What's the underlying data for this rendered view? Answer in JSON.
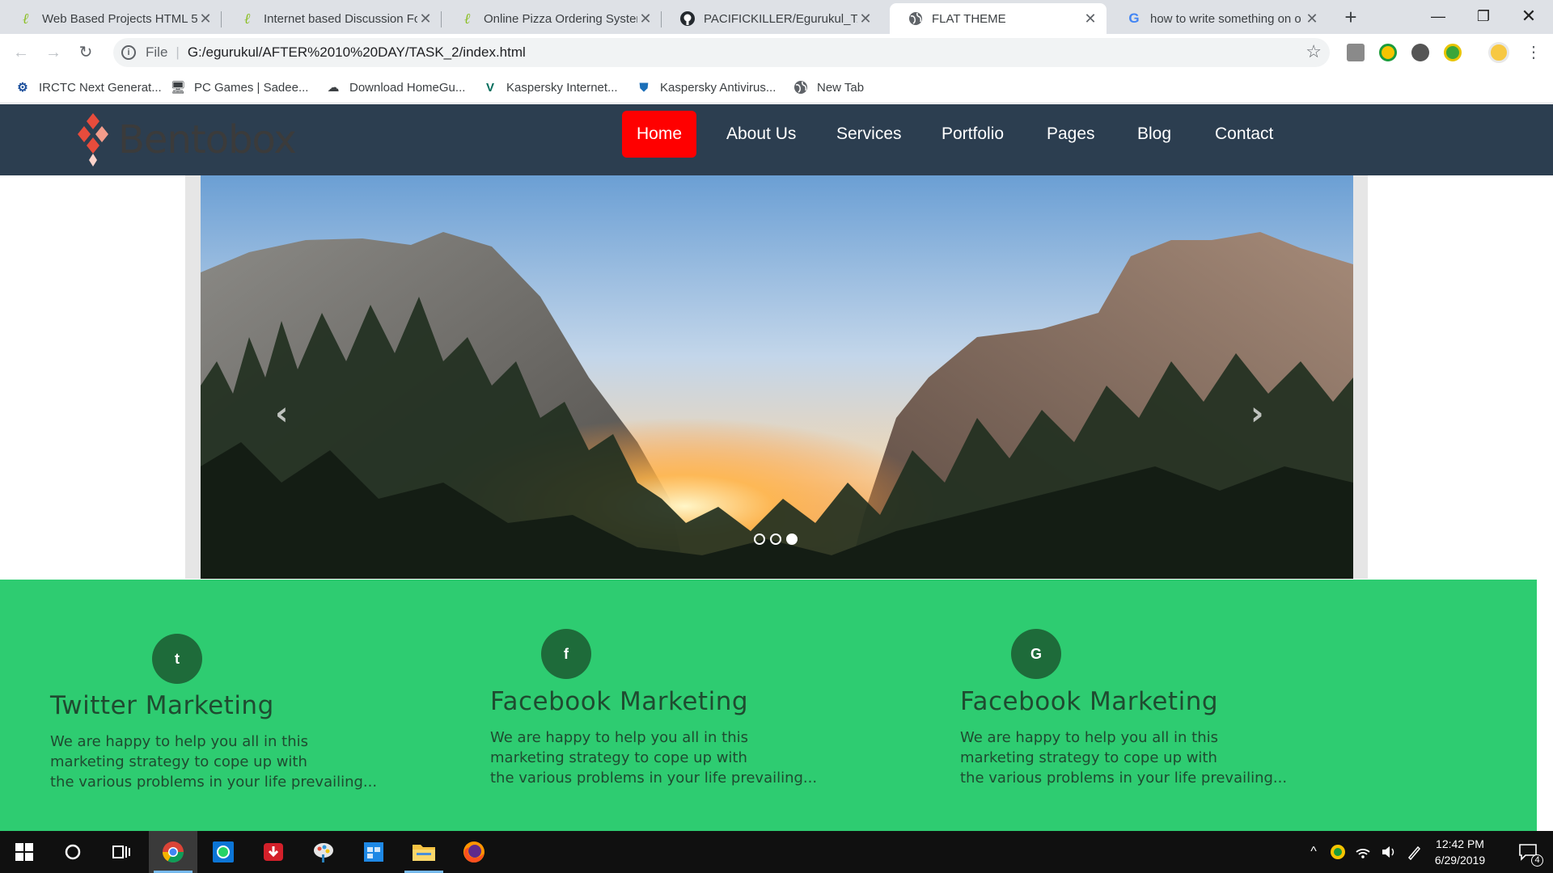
{
  "browser": {
    "tabs": [
      {
        "title": "Web Based Projects HTML 5 (",
        "icon": "leaf-icon",
        "active": false
      },
      {
        "title": "Internet based Discussion Fo",
        "icon": "leaf-icon",
        "active": false
      },
      {
        "title": "Online Pizza Ordering Systen",
        "icon": "leaf-icon",
        "active": false
      },
      {
        "title": "PACIFICKILLER/Egurukul_TAS",
        "icon": "github-icon",
        "active": false
      },
      {
        "title": "FLAT THEME",
        "icon": "globe-icon",
        "active": true
      },
      {
        "title": "how to write something on o",
        "icon": "google-icon",
        "active": false
      }
    ],
    "address": {
      "scheme": "File",
      "url": "G:/egurukul/AFTER%2010%20DAY/TASK_2/index.html"
    },
    "bookmarks": [
      {
        "label": "IRCTC Next Generat...",
        "icon": "irctc-icon"
      },
      {
        "label": "PC Games | Sadee...",
        "icon": "monitor-icon"
      },
      {
        "label": "Download HomeGu...",
        "icon": "cloud-download-icon"
      },
      {
        "label": "Kaspersky Internet...",
        "icon": "kaspersky-v-icon"
      },
      {
        "label": "Kaspersky Antivirus...",
        "icon": "shield-icon"
      },
      {
        "label": "New Tab",
        "icon": "globe-icon"
      }
    ]
  },
  "site": {
    "logo_text": "Bentobox",
    "nav": [
      "Home",
      "About Us",
      "Services",
      "Portfolio",
      "Pages",
      "Blog",
      "Contact"
    ],
    "active_nav": "Home",
    "slider": {
      "slides": 3,
      "active_slide": 3,
      "prev_icon": "chevron-left-icon",
      "next_icon": "chevron-right-icon"
    },
    "features": [
      {
        "icon_glyph": "t",
        "icon": "twitter-icon",
        "title": "Twitter Marketing",
        "lines": [
          "We are happy to help you all in this",
          "marketing strategy to cope up with",
          "the various problems in your life prevailing..."
        ]
      },
      {
        "icon_glyph": "f",
        "icon": "facebook-icon",
        "title": "Facebook Marketing",
        "lines": [
          "We are happy to help you all in this",
          "marketing strategy to cope up with",
          "the various problems in your life prevailing..."
        ]
      },
      {
        "icon_glyph": "G",
        "icon": "google-icon",
        "title": "Facebook Marketing",
        "lines": [
          "We are happy to help you all in this",
          "marketing strategy to cope up with",
          "the various problems in your life prevailing..."
        ]
      }
    ],
    "colors": {
      "header": "#2c3e50",
      "active_nav": "#ff0000",
      "features_bg": "#2ecc71",
      "feature_icon_bg": "#1e6b3a"
    }
  },
  "taskbar": {
    "time": "12:42 PM",
    "date": "6/29/2019",
    "notification_count": "4"
  }
}
